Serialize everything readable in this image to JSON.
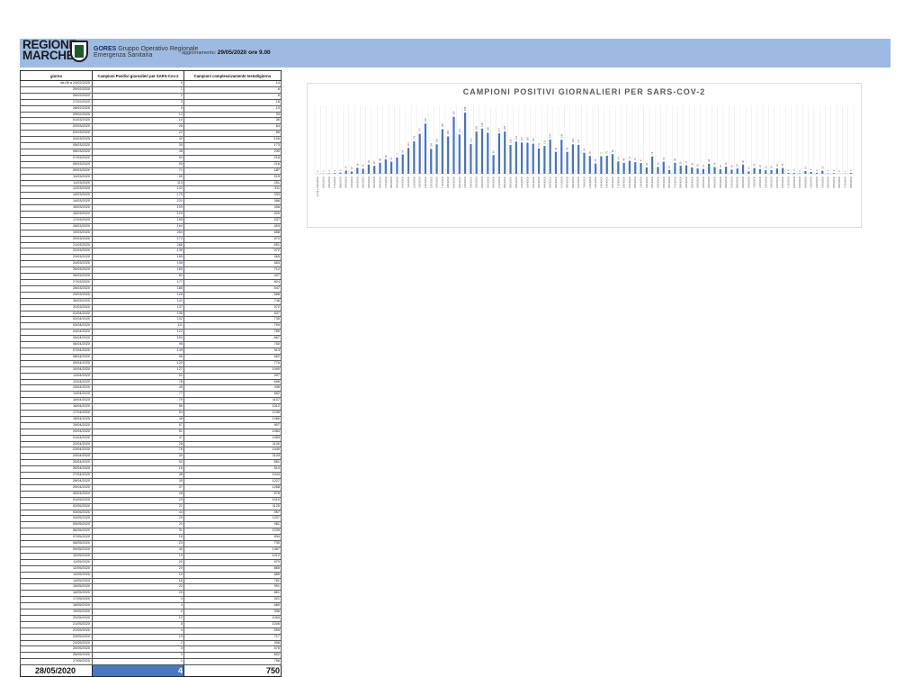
{
  "header": {
    "logo_line1": "REGIONE",
    "logo_line2": "MARCHE",
    "org_name": "GORES",
    "org_full1": "Gruppo Operativo Regionale",
    "org_full2": "Emergenza Sanitaria",
    "update_label": "aggiornamento:",
    "update_value": "29/05/2020 ore 9.00",
    "colors": {
      "band": "#9dbbe2",
      "bar": "#4472c4",
      "total_cell": "#4a78c0"
    }
  },
  "table": {
    "col_headers": [
      "giorno",
      "Campioni Positivi giornalieri per SARS-Cov-2",
      "Campioni complessivamente testati/giorno"
    ],
    "rows": [
      [
        "da 06 a 24/02/2020",
        "0",
        "14"
      ],
      [
        "25/02/2020",
        "1",
        "6"
      ],
      [
        "26/02/2020",
        "2",
        "8"
      ],
      [
        "27/02/2020",
        "3",
        "18"
      ],
      [
        "28/02/2020",
        "5",
        "19"
      ],
      [
        "29/02/2020",
        "14",
        "33"
      ],
      [
        "01/03/2020",
        "10",
        "36"
      ],
      [
        "02/03/2020",
        "26",
        "64"
      ],
      [
        "03/03/2020",
        "22",
        "86"
      ],
      [
        "04/03/2020",
        "40",
        "126"
      ],
      [
        "05/03/2020",
        "35",
        "173"
      ],
      [
        "06/03/2020",
        "48",
        "230"
      ],
      [
        "07/03/2020",
        "63",
        "218"
      ],
      [
        "08/03/2020",
        "53",
        "216"
      ],
      [
        "09/03/2020",
        "71",
        "187"
      ],
      [
        "10/03/2020",
        "85",
        "219"
      ],
      [
        "11/03/2020",
        "113",
        "251"
      ],
      [
        "12/03/2020",
        "142",
        "311"
      ],
      [
        "13/03/2020",
        "175",
        "333"
      ],
      [
        "14/03/2020",
        "220",
        "386"
      ],
      [
        "15/03/2020",
        "109",
        "306"
      ],
      [
        "16/03/2020",
        "129",
        "326"
      ],
      [
        "17/03/2020",
        "195",
        "537"
      ],
      [
        "18/03/2020",
        "164",
        "403"
      ],
      [
        "19/03/2020",
        "250",
        "658"
      ],
      [
        "20/03/2020",
        "172",
        "570"
      ],
      [
        "21/03/2020",
        "268",
        "651"
      ],
      [
        "22/03/2020",
        "130",
        "372"
      ],
      [
        "23/03/2020",
        "185",
        "465"
      ],
      [
        "24/03/2020",
        "198",
        "663"
      ],
      [
        "25/03/2020",
        "180",
        "712"
      ],
      [
        "26/03/2020",
        "82",
        "437"
      ],
      [
        "27/03/2020",
        "177",
        "824"
      ],
      [
        "28/03/2020",
        "185",
        "547"
      ],
      [
        "29/03/2020",
        "126",
        "588"
      ],
      [
        "30/03/2020",
        "141",
        "746"
      ],
      [
        "31/03/2020",
        "137",
        "572"
      ],
      [
        "01/04/2020",
        "136",
        "647"
      ],
      [
        "02/04/2020",
        "132",
        "735"
      ],
      [
        "03/04/2020",
        "111",
        "794"
      ],
      [
        "04/04/2020",
        "122",
        "780"
      ],
      [
        "05/04/2020",
        "150",
        "667"
      ],
      [
        "06/04/2020",
        "96",
        "700"
      ],
      [
        "07/04/2020",
        "149",
        "913"
      ],
      [
        "08/04/2020",
        "96",
        "662"
      ],
      [
        "09/04/2020",
        "129",
        "776"
      ],
      [
        "10/04/2020",
        "127",
        "1090"
      ],
      [
        "11/04/2020",
        "92",
        "997"
      ],
      [
        "12/04/2020",
        "78",
        "696"
      ],
      [
        "13/04/2020",
        "45",
        "436"
      ],
      [
        "14/04/2020",
        "77",
        "662"
      ],
      [
        "15/04/2020",
        "79",
        "1107"
      ],
      [
        "16/04/2020",
        "86",
        "1012"
      ],
      [
        "17/04/2020",
        "54",
        "1238"
      ],
      [
        "18/04/2020",
        "48",
        "1086"
      ],
      [
        "19/04/2020",
        "57",
        "907"
      ],
      [
        "20/04/2020",
        "51",
        "1084"
      ],
      [
        "21/04/2020",
        "47",
        "1453"
      ],
      [
        "22/04/2020",
        "28",
        "1130"
      ],
      [
        "23/04/2020",
        "76",
        "1440"
      ],
      [
        "24/04/2020",
        "30",
        "1143"
      ],
      [
        "25/04/2020",
        "53",
        "851"
      ],
      [
        "26/04/2020",
        "16",
        "510"
      ],
      [
        "27/04/2020",
        "48",
        "1044"
      ],
      [
        "28/04/2020",
        "35",
        "1227"
      ],
      [
        "29/04/2020",
        "37",
        "1268"
      ],
      [
        "30/04/2020",
        "28",
        "978"
      ],
      [
        "01/05/2020",
        "23",
        "1010"
      ],
      [
        "02/05/2020",
        "21",
        "1125"
      ],
      [
        "03/05/2020",
        "44",
        "557"
      ],
      [
        "04/05/2020",
        "29",
        "1207"
      ],
      [
        "05/05/2020",
        "20",
        "981"
      ],
      [
        "06/05/2020",
        "31",
        "1239"
      ],
      [
        "07/05/2020",
        "18",
        "834"
      ],
      [
        "08/05/2020",
        "23",
        "730"
      ],
      [
        "09/05/2020",
        "40",
        "1367"
      ],
      [
        "10/05/2020",
        "10",
        "1012"
      ],
      [
        "11/05/2020",
        "25",
        "970"
      ],
      [
        "12/05/2020",
        "20",
        "865"
      ],
      [
        "13/05/2020",
        "15",
        "886"
      ],
      [
        "14/05/2020",
        "16",
        "781"
      ],
      [
        "15/05/2020",
        "23",
        "991"
      ],
      [
        "16/05/2020",
        "25",
        "861"
      ],
      [
        "17/05/2020",
        "4",
        "321"
      ],
      [
        "18/05/2020",
        "4",
        "680"
      ],
      [
        "19/05/2020",
        "2",
        "936"
      ],
      [
        "20/05/2020",
        "12",
        "1063"
      ],
      [
        "21/05/2020",
        "8",
        "1006"
      ],
      [
        "22/05/2020",
        "4",
        "559"
      ],
      [
        "23/05/2020",
        "13",
        "717"
      ],
      [
        "24/05/2020",
        "2",
        "398"
      ],
      [
        "25/05/2020",
        "3",
        "576"
      ],
      [
        "26/05/2020",
        "0",
        "802"
      ],
      [
        "27/05/2020",
        "1",
        "796"
      ]
    ],
    "total_row": [
      "28/05/2020",
      "4",
      "750"
    ]
  },
  "chart_data": {
    "type": "bar",
    "title": "CAMPIONI POSITIVI GIORNALIERI PER SARS-COV-2",
    "xlabel": "",
    "ylabel": "",
    "ylim": [
      0,
      300
    ],
    "grid": true,
    "legend": "none",
    "categories": [
      "da 06 a 24/02/2020",
      "25/02/2020",
      "26/02/2020",
      "27/02/2020",
      "28/02/2020",
      "29/02/2020",
      "01/03/2020",
      "02/03/2020",
      "03/03/2020",
      "04/03/2020",
      "05/03/2020",
      "06/03/2020",
      "07/03/2020",
      "08/03/2020",
      "09/03/2020",
      "10/03/2020",
      "11/03/2020",
      "12/03/2020",
      "13/03/2020",
      "14/03/2020",
      "15/03/2020",
      "16/03/2020",
      "17/03/2020",
      "18/03/2020",
      "19/03/2020",
      "20/03/2020",
      "21/03/2020",
      "22/03/2020",
      "23/03/2020",
      "24/03/2020",
      "25/03/2020",
      "26/03/2020",
      "27/03/2020",
      "28/03/2020",
      "29/03/2020",
      "30/03/2020",
      "31/03/2020",
      "01/04/2020",
      "02/04/2020",
      "03/04/2020",
      "04/04/2020",
      "05/04/2020",
      "06/04/2020",
      "07/04/2020",
      "08/04/2020",
      "09/04/2020",
      "10/04/2020",
      "11/04/2020",
      "12/04/2020",
      "13/04/2020",
      "14/04/2020",
      "15/04/2020",
      "16/04/2020",
      "17/04/2020",
      "18/04/2020",
      "19/04/2020",
      "20/04/2020",
      "21/04/2020",
      "22/04/2020",
      "23/04/2020",
      "24/04/2020",
      "25/04/2020",
      "26/04/2020",
      "27/04/2020",
      "28/04/2020",
      "29/04/2020",
      "30/04/2020",
      "01/05/2020",
      "02/05/2020",
      "03/05/2020",
      "04/05/2020",
      "05/05/2020",
      "06/05/2020",
      "07/05/2020",
      "08/05/2020",
      "09/05/2020",
      "10/05/2020",
      "11/05/2020",
      "12/05/2020",
      "13/05/2020",
      "14/05/2020",
      "15/05/2020",
      "16/05/2020",
      "17/05/2020",
      "18/05/2020",
      "19/05/2020",
      "20/05/2020",
      "21/05/2020",
      "22/05/2020",
      "23/05/2020",
      "24/05/2020",
      "25/05/2020",
      "26/05/2020",
      "27/05/2020",
      "28/05/2020"
    ],
    "values": [
      0,
      1,
      2,
      3,
      5,
      14,
      10,
      26,
      22,
      40,
      35,
      48,
      63,
      53,
      71,
      85,
      113,
      142,
      175,
      220,
      109,
      129,
      195,
      164,
      250,
      172,
      268,
      130,
      185,
      198,
      180,
      82,
      177,
      185,
      126,
      141,
      137,
      136,
      132,
      111,
      122,
      150,
      96,
      149,
      96,
      129,
      127,
      92,
      78,
      45,
      77,
      79,
      86,
      54,
      48,
      57,
      51,
      47,
      28,
      76,
      30,
      53,
      16,
      48,
      35,
      37,
      28,
      23,
      21,
      44,
      29,
      20,
      31,
      18,
      23,
      40,
      10,
      25,
      20,
      15,
      16,
      23,
      25,
      4,
      4,
      2,
      12,
      8,
      4,
      13,
      2,
      3,
      0,
      1,
      4
    ]
  }
}
